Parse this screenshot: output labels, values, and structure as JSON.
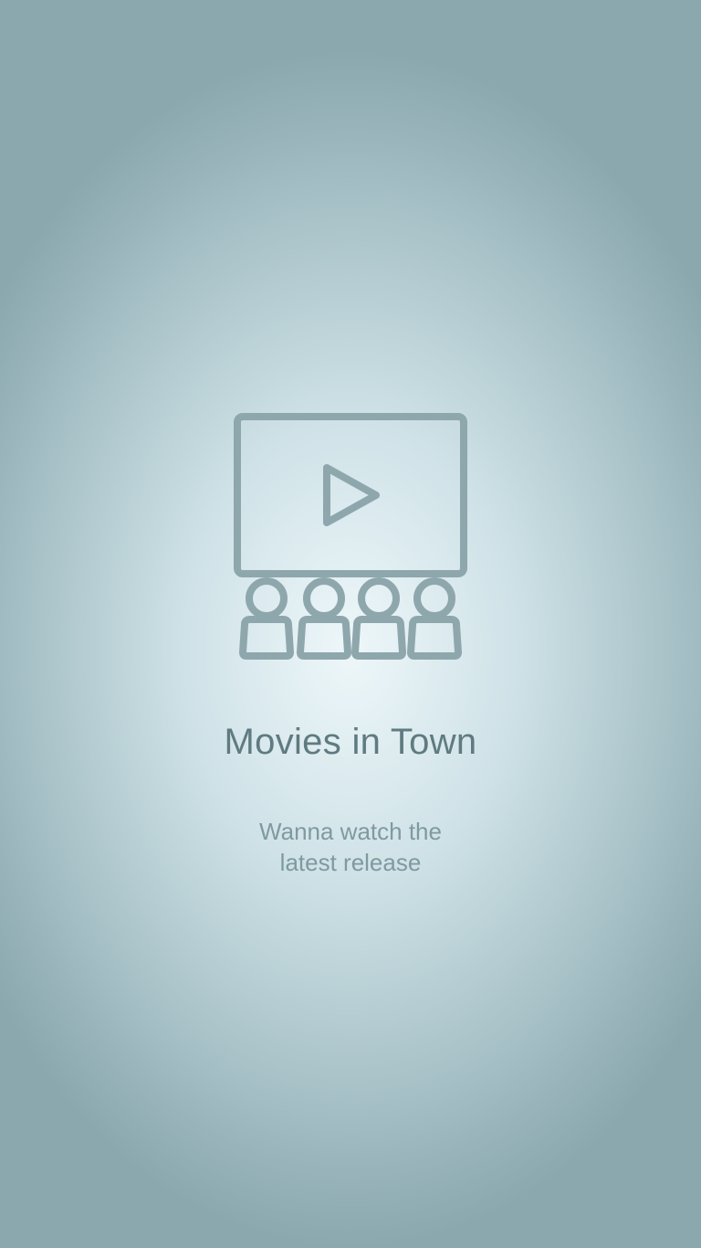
{
  "screen": {
    "icon": "cinema-screen-audience-icon",
    "title": "Movies in Town",
    "subtitle_line1": "Wanna watch the",
    "subtitle_line2": "latest release",
    "colors": {
      "icon_stroke": "#8ea7ac",
      "title": "#5f7b81",
      "subtitle": "#7e9aa0",
      "background_center": "#eef7fa",
      "background_edge": "#8aa8ae"
    }
  }
}
